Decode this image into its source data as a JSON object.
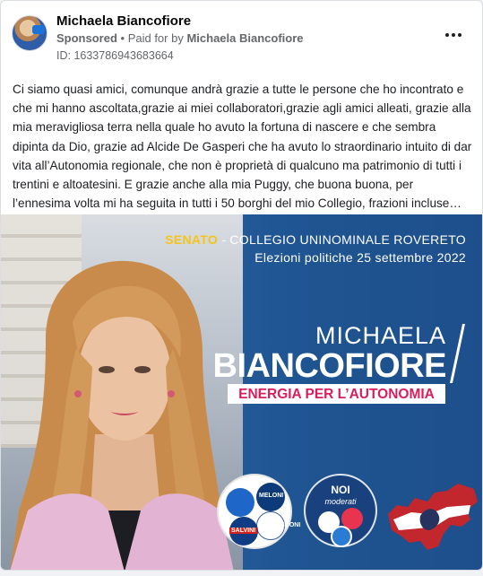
{
  "post": {
    "page_name": "Michaela Biancofiore",
    "sponsored_label": "Sponsored",
    "separator": " • ",
    "paid_for_label": "Paid for by ",
    "payer_name": "Michaela Biancofiore",
    "id_label": "ID: 1633786943683664",
    "more_icon": "more-horizontal-icon",
    "body_text": "Ci siamo quasi amici, comunque andrà grazie a tutte le persone che ho incontrato e che mi hanno ascoltata,grazie ai miei collaboratori,grazie agli amici alleati, grazie alla mia meravigliosa terra nella quale ho avuto la fortuna di nascere e che sembra dipinta da Dio, grazie ad Alcide De Gasperi che ha avuto lo straordinario intuito di dar vita all’Autonomia regionale, che non è proprietà di qualcuno ma patrimonio di tutti i trentini e altoatesini. E grazie anche alla mia Puggy, che buona buona, per l’ennesima volta mi ha seguita in tutti i 50 borghi del mio Collegio, frazioni incluse…"
  },
  "creative": {
    "senato": "SENATO",
    "collegio": " - COLLEGIO UNINOMINALE ROVERETO",
    "elezioni": "Elezioni politiche 25 settembre 2022",
    "name_first": "MICHAELA",
    "name_last": "BIANCOFIORE",
    "slogan": "ENERGIA PER L’AUTONOMIA",
    "logo_tags": {
      "salvini": "SALVINI",
      "meloni": "MELONI",
      "forza": "BERLUSCONI",
      "noi_title": "NOI",
      "noi_sub": "moderati"
    }
  },
  "colors": {
    "accent_yellow": "#f4c518",
    "slogan_magenta": "#d81e5b",
    "banner_blue": "#1f5592"
  }
}
